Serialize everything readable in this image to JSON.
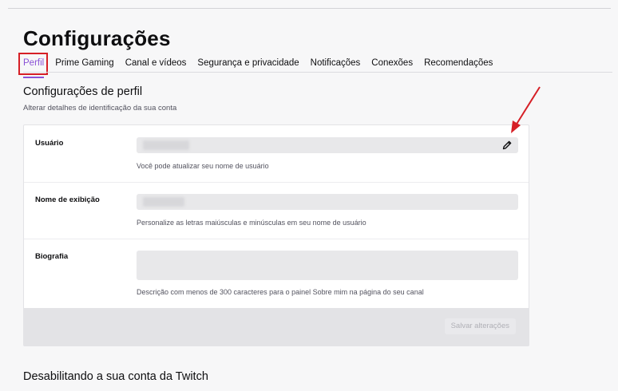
{
  "page": {
    "title": "Configurações"
  },
  "tabs": [
    {
      "label": "Perfil",
      "active": true
    },
    {
      "label": "Prime Gaming",
      "active": false
    },
    {
      "label": "Canal e vídeos",
      "active": false
    },
    {
      "label": "Segurança e privacidade",
      "active": false
    },
    {
      "label": "Notificações",
      "active": false
    },
    {
      "label": "Conexões",
      "active": false
    },
    {
      "label": "Recomendações",
      "active": false
    }
  ],
  "profile_section": {
    "title": "Configurações de perfil",
    "description": "Alterar detalhes de identificação da sua conta",
    "rows": {
      "username": {
        "label": "Usuário",
        "hint": "Você pode atualizar seu nome de usuário",
        "icon": "pencil-icon"
      },
      "display_name": {
        "label": "Nome de exibição",
        "hint": "Personalize as letras maiúsculas e minúsculas em seu nome de usuário"
      },
      "bio": {
        "label": "Biografia",
        "hint": "Descrição com menos de 300 caracteres para o painel Sobre mim na página do seu canal"
      }
    },
    "save_label": "Salvar alterações"
  },
  "disable_section": {
    "title": "Desabilitando a sua conta da Twitch"
  },
  "colors": {
    "accent": "#8a52d6",
    "highlight": "#d61f26"
  }
}
